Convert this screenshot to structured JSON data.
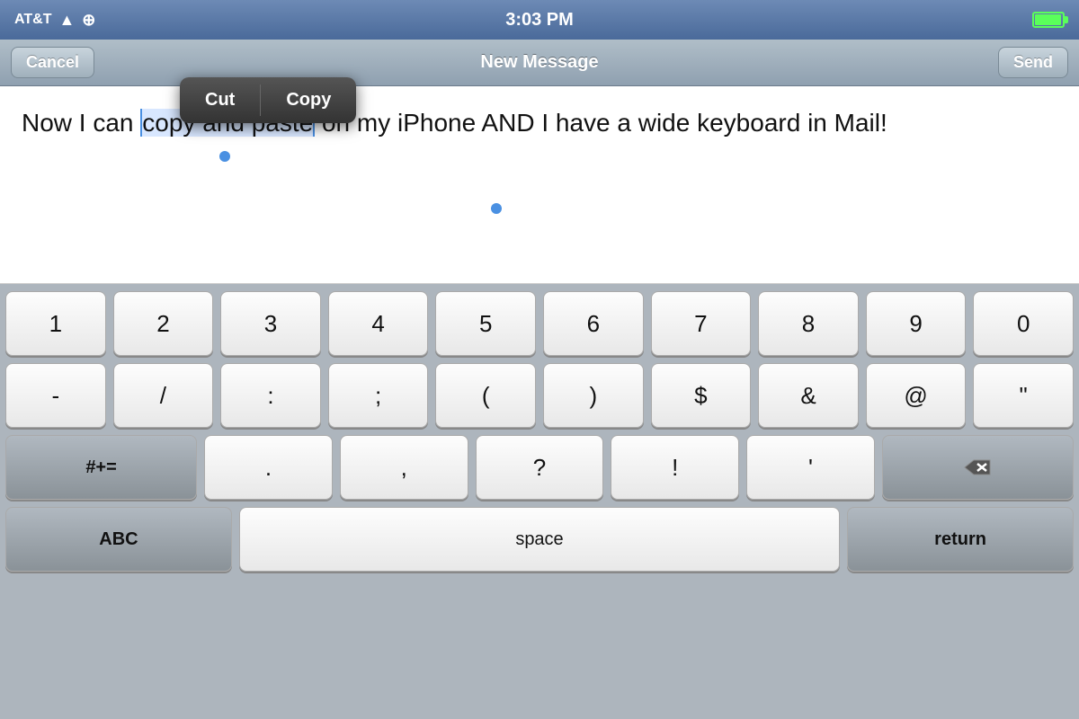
{
  "status_bar": {
    "carrier": "AT&T",
    "time": "3:03 PM"
  },
  "nav": {
    "cancel_label": "Cancel",
    "title": "New Message",
    "send_label": "Send"
  },
  "context_menu": {
    "cut_label": "Cut",
    "copy_label": "Copy"
  },
  "text_area": {
    "before_selection": "Now I can ",
    "selected": "copy and paste",
    "after_selection": " on my iPhone AND I have a wide keyboard in Mail!"
  },
  "keyboard": {
    "row1": [
      "1",
      "2",
      "3",
      "4",
      "5",
      "6",
      "7",
      "8",
      "9",
      "0"
    ],
    "row2": [
      "-",
      "/",
      ":",
      ";",
      "(",
      ")",
      "$",
      "&",
      "@",
      "\""
    ],
    "row3_left": "#+=",
    "row3_mid": [
      ".",
      ",",
      "?",
      "!",
      "'"
    ],
    "row3_right": "⌫",
    "row4_left": "ABC",
    "row4_mid": "space",
    "row4_right": "return"
  }
}
